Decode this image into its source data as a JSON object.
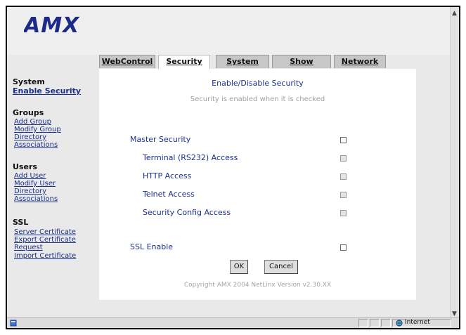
{
  "brand": {
    "logo_text": "AMX"
  },
  "tabs": [
    {
      "label": "WebControl",
      "active": false
    },
    {
      "label": "Security",
      "active": true
    },
    {
      "label": "System",
      "active": false
    },
    {
      "label": "Show Devices",
      "active": false
    },
    {
      "label": "Network",
      "active": false
    }
  ],
  "sidebar": {
    "system": {
      "heading": "System",
      "links": [
        "Enable Security"
      ]
    },
    "groups": {
      "heading": "Groups",
      "links": [
        "Add Group",
        "Modify Group",
        "Directory",
        "Associations"
      ]
    },
    "users": {
      "heading": "Users",
      "links": [
        "Add User",
        "Modify User",
        "Directory",
        "Associations"
      ]
    },
    "ssl": {
      "heading": "SSL",
      "links": [
        "Server Certificate",
        "Export Certificate",
        "Request",
        "Import Certificate"
      ]
    }
  },
  "panel": {
    "title": "Enable/Disable Security",
    "subtitle": "Security is enabled when it is checked",
    "options": [
      {
        "label": "Master Security",
        "checked": false
      },
      {
        "label": "Terminal (RS232) Access",
        "checked": false
      },
      {
        "label": "HTTP Access",
        "checked": false
      },
      {
        "label": "Telnet Access",
        "checked": false
      },
      {
        "label": "Security Config Access",
        "checked": false
      },
      {
        "label": "SSL Enable",
        "checked": false
      }
    ],
    "ok_label": "OK",
    "cancel_label": "Cancel",
    "copyright": "Copyright AMX 2004   NetLinx Version v2.30.XX"
  },
  "statusbar": {
    "zone_label": "Internet"
  },
  "colors": {
    "link": "#1a2f8a",
    "logo": "#1d2a88",
    "panel_bg": "#ffffff",
    "chrome_bg": "#e9e9e9"
  },
  "icons": {
    "page": "ie-page-icon",
    "zone": "globe-icon"
  }
}
